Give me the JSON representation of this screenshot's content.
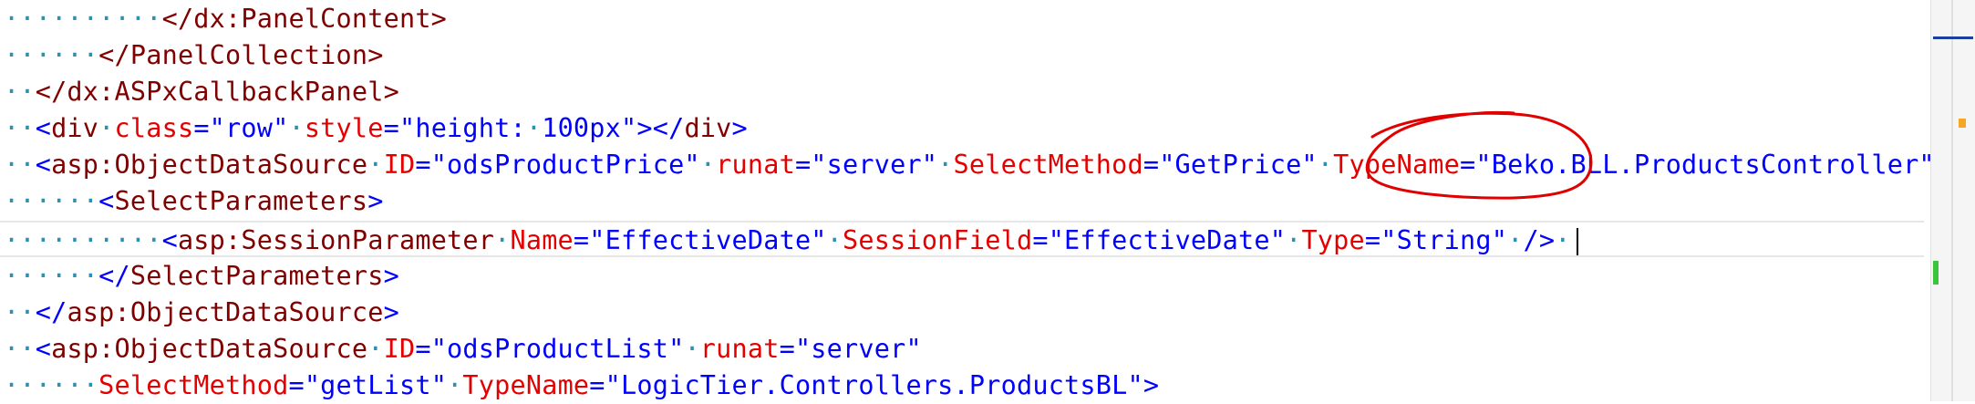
{
  "lines": [
    {
      "segments": [
        {
          "t": "ws",
          "v": "··········"
        },
        {
          "t": "tag",
          "v": "</dx:PanelContent>"
        }
      ]
    },
    {
      "segments": [
        {
          "t": "ws",
          "v": "······"
        },
        {
          "t": "tag",
          "v": "</PanelCollection>"
        }
      ]
    },
    {
      "segments": [
        {
          "t": "ws",
          "v": "··"
        },
        {
          "t": "tag",
          "v": "</dx:ASPxCallbackPanel>"
        }
      ]
    },
    {
      "segments": [
        {
          "t": "ws",
          "v": "··"
        },
        {
          "t": "punc",
          "v": "<"
        },
        {
          "t": "tag",
          "v": "div"
        },
        {
          "t": "ws",
          "v": "·"
        },
        {
          "t": "attr",
          "v": "class"
        },
        {
          "t": "eq",
          "v": "="
        },
        {
          "t": "str",
          "v": "\"row\""
        },
        {
          "t": "ws",
          "v": "·"
        },
        {
          "t": "attr",
          "v": "style"
        },
        {
          "t": "eq",
          "v": "="
        },
        {
          "t": "str",
          "v": "\"height:"
        },
        {
          "t": "ws",
          "v": "·"
        },
        {
          "t": "str",
          "v": "100px\""
        },
        {
          "t": "punc",
          "v": "></"
        },
        {
          "t": "tag",
          "v": "div"
        },
        {
          "t": "punc",
          "v": ">"
        }
      ]
    },
    {
      "segments": [
        {
          "t": "ws",
          "v": "··"
        },
        {
          "t": "punc",
          "v": "<"
        },
        {
          "t": "tag",
          "v": "asp:ObjectDataSource"
        },
        {
          "t": "ws",
          "v": "·"
        },
        {
          "t": "attr",
          "v": "ID"
        },
        {
          "t": "eq",
          "v": "="
        },
        {
          "t": "str",
          "v": "\"odsProductPrice\""
        },
        {
          "t": "ws",
          "v": "·"
        },
        {
          "t": "attr",
          "v": "runat"
        },
        {
          "t": "eq",
          "v": "="
        },
        {
          "t": "str",
          "v": "\"server\""
        },
        {
          "t": "ws",
          "v": "·"
        },
        {
          "t": "attr",
          "v": "SelectMethod"
        },
        {
          "t": "eq",
          "v": "="
        },
        {
          "t": "str",
          "v": "\"GetPrice\""
        },
        {
          "t": "ws",
          "v": "·"
        },
        {
          "t": "attr",
          "v": "TypeName"
        },
        {
          "t": "eq",
          "v": "="
        },
        {
          "t": "str",
          "v": "\"Beko.BLL.ProductsController\""
        },
        {
          "t": "punc",
          "v": ">"
        }
      ]
    },
    {
      "segments": [
        {
          "t": "ws",
          "v": "······"
        },
        {
          "t": "punc",
          "v": "<"
        },
        {
          "t": "tag",
          "v": "SelectParameters"
        },
        {
          "t": "punc",
          "v": ">"
        }
      ]
    },
    {
      "current": true,
      "segments": [
        {
          "t": "ws",
          "v": "··········"
        },
        {
          "t": "punc",
          "v": "<"
        },
        {
          "t": "tag",
          "v": "asp:SessionParameter"
        },
        {
          "t": "ws",
          "v": "·"
        },
        {
          "t": "attr",
          "v": "Name"
        },
        {
          "t": "eq",
          "v": "="
        },
        {
          "t": "str",
          "v": "\"EffectiveDate\""
        },
        {
          "t": "ws",
          "v": "·"
        },
        {
          "t": "attr",
          "v": "SessionField"
        },
        {
          "t": "eq",
          "v": "="
        },
        {
          "t": "str",
          "v": "\"EffectiveDate\""
        },
        {
          "t": "ws",
          "v": "·"
        },
        {
          "t": "attr",
          "v": "Type"
        },
        {
          "t": "eq",
          "v": "="
        },
        {
          "t": "str",
          "v": "\"String\""
        },
        {
          "t": "ws",
          "v": "·"
        },
        {
          "t": "punc",
          "v": "/>"
        },
        {
          "t": "ws",
          "v": "·"
        }
      ]
    },
    {
      "segments": [
        {
          "t": "ws",
          "v": "······"
        },
        {
          "t": "punc",
          "v": "</"
        },
        {
          "t": "tag",
          "v": "SelectParameters"
        },
        {
          "t": "punc",
          "v": ">"
        }
      ]
    },
    {
      "segments": [
        {
          "t": "ws",
          "v": "··"
        },
        {
          "t": "punc",
          "v": "</"
        },
        {
          "t": "tag",
          "v": "asp:ObjectDataSource"
        },
        {
          "t": "punc",
          "v": ">"
        }
      ]
    },
    {
      "segments": [
        {
          "t": "ws",
          "v": "··"
        },
        {
          "t": "punc",
          "v": "<"
        },
        {
          "t": "tag",
          "v": "asp:ObjectDataSource"
        },
        {
          "t": "ws",
          "v": "·"
        },
        {
          "t": "attr",
          "v": "ID"
        },
        {
          "t": "eq",
          "v": "="
        },
        {
          "t": "str",
          "v": "\"odsProductList\""
        },
        {
          "t": "ws",
          "v": "·"
        },
        {
          "t": "attr",
          "v": "runat"
        },
        {
          "t": "eq",
          "v": "="
        },
        {
          "t": "str",
          "v": "\"server\""
        }
      ]
    },
    {
      "segments": [
        {
          "t": "ws",
          "v": "······"
        },
        {
          "t": "attr",
          "v": "SelectMethod"
        },
        {
          "t": "eq",
          "v": "="
        },
        {
          "t": "str",
          "v": "\"getList\""
        },
        {
          "t": "ws",
          "v": "·"
        },
        {
          "t": "attr",
          "v": "TypeName"
        },
        {
          "t": "eq",
          "v": "="
        },
        {
          "t": "str",
          "v": "\"LogicTier.Controllers.ProductsBL\""
        },
        {
          "t": "punc",
          "v": ">"
        }
      ]
    }
  ],
  "colors": {
    "whitespace": "#2b91af",
    "tag": "#800000",
    "attribute": "#e50000",
    "string": "#0000ff",
    "annotation": "#e00000",
    "marker_orange": "#f5a623",
    "marker_green": "#3cc43c",
    "marker_blue": "#1a3fa0"
  },
  "annotation": {
    "shape": "freehand-ellipse",
    "color": "#e00000"
  }
}
